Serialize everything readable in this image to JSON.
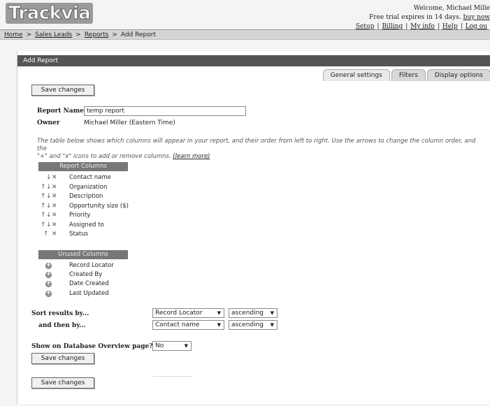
{
  "header": {
    "logo": "Trackvia",
    "welcome": "Welcome, Michael Mille",
    "trial_text": "Free trial expires in 14 days.",
    "buy_now": "buy now",
    "links": [
      "Setup",
      "Billing",
      "My info",
      "Help",
      "Log ou"
    ]
  },
  "breadcrumb": [
    "Home",
    "Sales Leads",
    "Reports",
    "Add Report"
  ],
  "panel": {
    "title": "Add Report",
    "tabs": [
      "General settings",
      "Filters",
      "Display options"
    ],
    "save_label": "Save changes",
    "report_name_label": "Report Name",
    "report_name_value": "temp report",
    "owner_label": "Owner",
    "owner_value": "Michael Miller (Eastern Time)",
    "help_text_1": "The table below shows which columns will appear in your report, and their order from left to right. Use the arrows to change the column order, and the",
    "help_text_2": "\"+\" and \"x\" icons to add or remove columns.",
    "learn_more": "(learn more)",
    "report_columns_title": "Report Columns",
    "report_columns": [
      "Contact name",
      "Organization",
      "Description",
      "Opportunity size ($)",
      "Priority",
      "Assigned to",
      "Status"
    ],
    "unused_columns_title": "Unused Columns",
    "unused_columns": [
      "Record Locator",
      "Created By",
      "Date Created",
      "Last Updated"
    ],
    "sort_label": "Sort results by...",
    "then_label": "and then by...",
    "sort1_field": "Record Locator",
    "sort1_order": "ascending",
    "sort2_field": "Contact name",
    "sort2_order": "ascending",
    "overview_label": "Show on Database Overview page?",
    "overview_value": "No"
  }
}
